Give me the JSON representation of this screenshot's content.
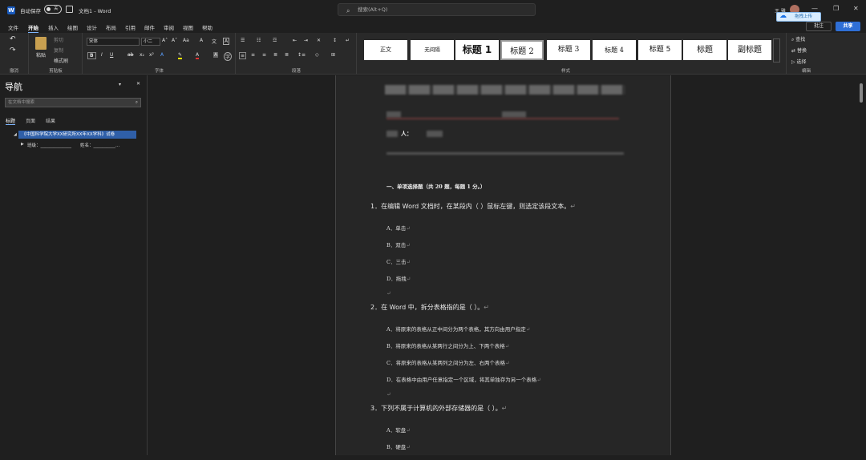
{
  "titlebar": {
    "logo": "W",
    "autosave_label": "自动保存",
    "toggle_state": "关",
    "doc_title": "文档1 - Word",
    "search_placeholder": "搜索(Alt+Q)",
    "user_name": "王 雅",
    "upload_label": "拖拽上传",
    "win_min": "—",
    "win_max": "❐",
    "win_close": "✕"
  },
  "menu": {
    "items": [
      "文件",
      "开始",
      "插入",
      "绘图",
      "设计",
      "布局",
      "引用",
      "邮件",
      "审阅",
      "视图",
      "帮助"
    ],
    "active": "开始",
    "comment_label": "批注",
    "share_label": "共享"
  },
  "ribbon": {
    "undo": {
      "label": "撤消"
    },
    "clipboard": {
      "paste": "粘贴",
      "cut": "剪切",
      "copy": "复制",
      "format_painter": "格式刷",
      "label": "剪贴板"
    },
    "font": {
      "name": "宋体",
      "size": "小二",
      "label": "字体"
    },
    "paragraph": {
      "label": "段落"
    },
    "styles": {
      "items": [
        "正文",
        "无间隔",
        "标题 1",
        "标题 2",
        "标题 3",
        "标题 4",
        "标题 5",
        "标题",
        "副标题"
      ],
      "selected": "标题 2",
      "label": "样式"
    },
    "editing": {
      "find": "查找",
      "replace": "替换",
      "select": "选择",
      "label": "编辑"
    }
  },
  "nav": {
    "title": "导航",
    "search_placeholder": "在文档中搜索",
    "tabs": [
      "标题",
      "页面",
      "结果"
    ],
    "active_tab": "标题",
    "heading_selected": "《中国科学院大学XX研究所XX年XX学科》试卷",
    "heading_sub": "班级：______________　　姓名：__________..."
  },
  "doc": {
    "section": "一、单项选择题（共 20 题，每题 1 分。）",
    "person_label": "人：",
    "questions": [
      {
        "text": "1．在编辑 Word 文档时，在某段内（ ）鼠标左键，则选定该段文本。",
        "options": [
          "A．单击",
          "B．双击",
          "C．三击",
          "D．拖拽"
        ]
      },
      {
        "text": "2．在 Word 中，拆分表格指的是（ ）。",
        "options": [
          "A．将原来的表格从正中间分为两个表格，其方向由用户指定",
          "B．将原来的表格从某两行之间分为上、下两个表格",
          "C．将原来的表格从某两列之间分为左、右两个表格",
          "D．在表格中由用户任意指定一个区域，将其单独存为另一个表格"
        ]
      },
      {
        "text": "3．下列不属于计算机的外部存储器的是（ ）。",
        "options": [
          "A．软盘",
          "B．硬盘"
        ]
      }
    ],
    "para_mark": "↵"
  }
}
